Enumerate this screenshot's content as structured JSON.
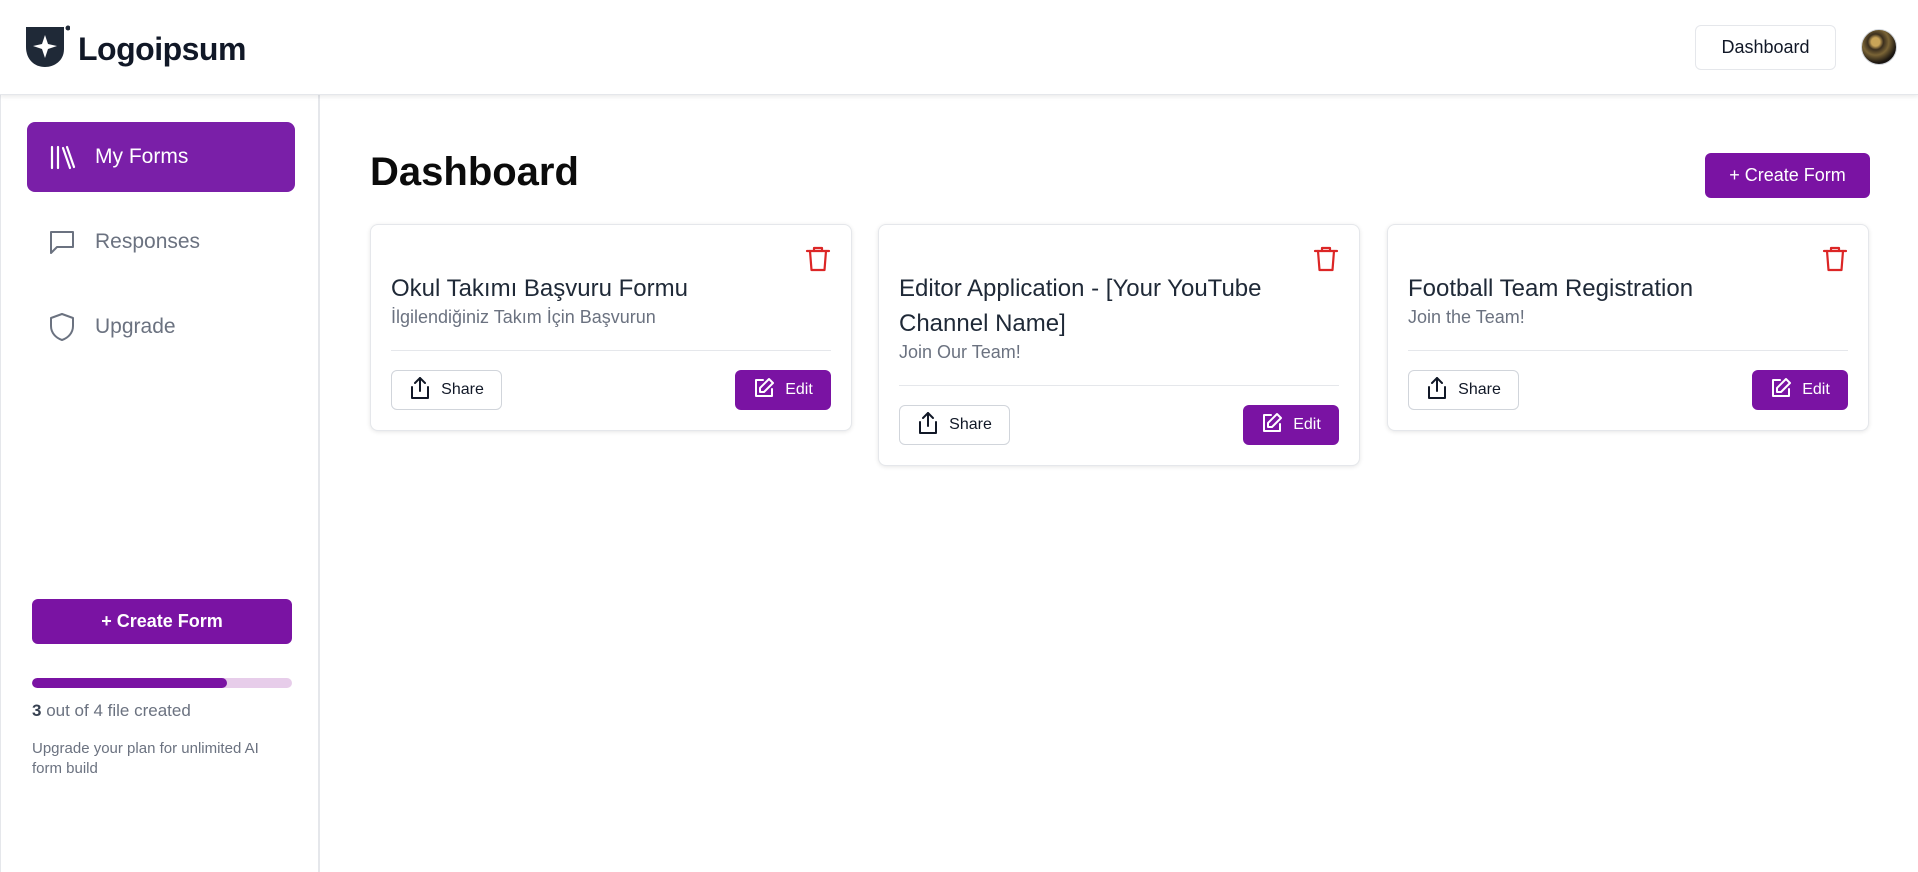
{
  "brand": {
    "name": "Logoipsum",
    "icon": "logo-mark-icon"
  },
  "topbar": {
    "dashboard_button": "Dashboard",
    "avatar": "user-avatar"
  },
  "sidebar": {
    "items": [
      {
        "label": "My Forms",
        "icon": "library-icon",
        "active": true
      },
      {
        "label": "Responses",
        "icon": "chat-bubble-icon",
        "active": false
      },
      {
        "label": "Upgrade",
        "icon": "shield-icon",
        "active": false
      }
    ],
    "create_button": "+ Create Form",
    "usage": {
      "created": "3",
      "suffix": "out of 4 file created",
      "progress_fraction": 0.75
    },
    "upgrade_note": "Upgrade your plan for unlimited AI form build"
  },
  "main": {
    "title": "Dashboard",
    "create_button": "+ Create Form",
    "cards": [
      {
        "title": "Okul Takımı Başvuru Formu",
        "subtitle": "İlgilendiğiniz Takım İçin Başvurun",
        "share": "Share",
        "edit": "Edit"
      },
      {
        "title": "Editor Application - [Your YouTube Channel Name]",
        "subtitle": "Join Our Team!",
        "share": "Share",
        "edit": "Edit"
      },
      {
        "title": "Football Team Registration",
        "subtitle": "Join the Team!",
        "share": "Share",
        "edit": "Edit"
      }
    ]
  },
  "colors": {
    "accent": "#7a13a3",
    "danger": "#dc2626",
    "muted": "#6b7280"
  }
}
